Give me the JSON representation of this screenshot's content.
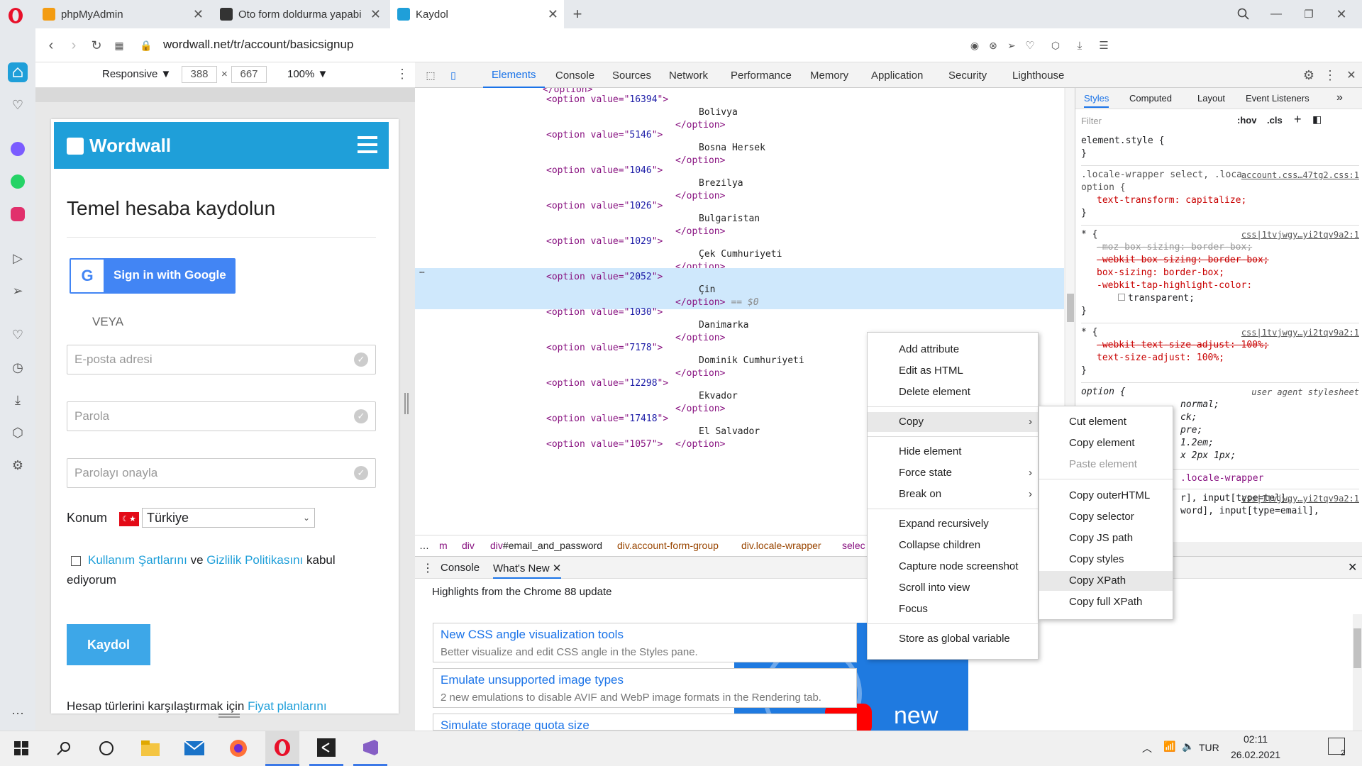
{
  "tabs": [
    {
      "label": "phpMyAdmin"
    },
    {
      "label": "Oto form doldurma yapabi"
    },
    {
      "label": "Kaydol"
    }
  ],
  "address": {
    "url": "wordwall.net/tr/account/basicsignup"
  },
  "device_toolbar": {
    "mode": "Responsive ▼",
    "width": "388",
    "x": "×",
    "height": "667",
    "zoom": "100% ▼"
  },
  "devtools": {
    "tabs": [
      "Elements",
      "Console",
      "Sources",
      "Network",
      "Performance",
      "Memory",
      "Application",
      "Security",
      "Lighthouse"
    ],
    "active_tab": "Elements",
    "styles_tabs": [
      "Styles",
      "Computed",
      "Layout",
      "Event Listeners",
      "»"
    ],
    "filter_placeholder": "Filter",
    "hov": ":hov",
    "cls": ".cls"
  },
  "elements": [
    {
      "value": "16394",
      "country": "Bolivya"
    },
    {
      "value": "5146",
      "country": "Bosna Hersek"
    },
    {
      "value": "1046",
      "country": "Brezilya"
    },
    {
      "value": "1026",
      "country": "Bulgaristan"
    },
    {
      "value": "1029",
      "country": "Çek Cumhuriyeti"
    },
    {
      "value": "2052",
      "country": "Çin",
      "selected": true
    },
    {
      "value": "1030",
      "country": "Danimarka"
    },
    {
      "value": "7178",
      "country": "Dominik Cumhuriyeti"
    },
    {
      "value": "12298",
      "country": "Ekvador"
    },
    {
      "value": "17418",
      "country": "El Salvador"
    }
  ],
  "el_strings": {
    "open": "<option value=\"",
    "close": "\">",
    "end": "</option>",
    "eq": "== $0",
    "top_partial": "</option>",
    "bottom_partial": "<option value=\"1057\">"
  },
  "styles": {
    "element_style": "element.style {",
    "brace_close": "}",
    "rule1_sel": ".locale-wrapper select, .locale-wrapper select option {",
    "rule1_src": "account.css…47tg2.css:1",
    "rule1_prop": "text-transform: capitalize;",
    "rule2_sel": "* {",
    "rule2_src": "css|1tvjwgy…yi2tqv9a2:1",
    "rule2_p1": "-moz-box-sizing: border-box;",
    "rule2_p2": "-webkit-box-sizing: border-box;",
    "rule2_p3": "box-sizing: border-box;",
    "rule2_p4": "-webkit-tap-highlight-color:",
    "rule2_p4v": "transparent;",
    "rule3_sel": "* {",
    "rule3_src": "css|1tvjwgy…yi2tqv9a2:1",
    "rule3_p1": "-webkit-text-size-adjust: 100%;",
    "rule3_p2": "text-size-adjust: 100%;",
    "rule4_sel": "option {",
    "rule4_src": "user agent stylesheet",
    "rule4_l1": "normal;",
    "rule4_l2": "ck;",
    "rule4_l3": "pre;",
    "rule4_l4": "1.2em;",
    "rule4_l5": "x 2px 1px;",
    "inherited": ".locale-wrapper",
    "rule5_src": "css|1tvjwgy…yi2tqv9a2:1",
    "rule5_l1": "r], input[type=tel],",
    "rule5_l2": "word], input[type=email],"
  },
  "breadcrumb": [
    "…",
    "m",
    "div",
    "div#email_and_password",
    "div.account-form-group",
    "div.locale-wrapper",
    "selec"
  ],
  "drawer": {
    "tabs": [
      "Console",
      "What's New"
    ],
    "headline": "Highlights from the Chrome 88 update",
    "cards": [
      {
        "title": "New CSS angle visualization tools",
        "desc": "Better visualize and edit CSS angle in the Styles pane."
      },
      {
        "title": "Emulate unsupported image types",
        "desc": "2 new emulations to disable AVIF and WebP image formats in the Rendering tab."
      },
      {
        "title": "Simulate storage quota size",
        "desc": ""
      }
    ],
    "video_text": "new"
  },
  "context_menu": {
    "items": [
      "Add attribute",
      "Edit as HTML",
      "Delete element",
      "Copy",
      "Hide element",
      "Force state",
      "Break on",
      "Expand recursively",
      "Collapse children",
      "Capture node screenshot",
      "Scroll into view",
      "Focus",
      "Store as global variable"
    ],
    "arrow": "›"
  },
  "submenu": {
    "items": [
      "Cut element",
      "Copy element",
      "Paste element",
      "Copy outerHTML",
      "Copy selector",
      "Copy JS path",
      "Copy styles",
      "Copy XPath",
      "Copy full XPath"
    ]
  },
  "page": {
    "brand": "Wordwall",
    "title": "Temel hesaba kaydolun",
    "google_btn": "Sign in with Google",
    "or": "VEYA",
    "email_ph": "E-posta adresi",
    "password_ph": "Parola",
    "confirm_ph": "Parolayı onayla",
    "location_label": "Konum",
    "location_value": "Türkiye",
    "terms_link1": "Kullanım Şartlarını",
    "terms_and": " ve ",
    "terms_link2": "Gizlilik Politikasını",
    "terms_rest": " kabul",
    "terms_rest2": "ediyorum",
    "submit": "Kaydol",
    "compare_text": "Hesap türlerini karşılaştırmak için ",
    "compare_link": "Fiyat planlarını"
  },
  "taskbar": {
    "lang": "TUR",
    "time": "02:11",
    "date": "26.02.2021",
    "notif": "2"
  },
  "colors": {
    "brand": "#1f9fd9",
    "accent": "#1a73e8",
    "selected_row": "#cfe8fc",
    "opera": "#e8102a"
  }
}
